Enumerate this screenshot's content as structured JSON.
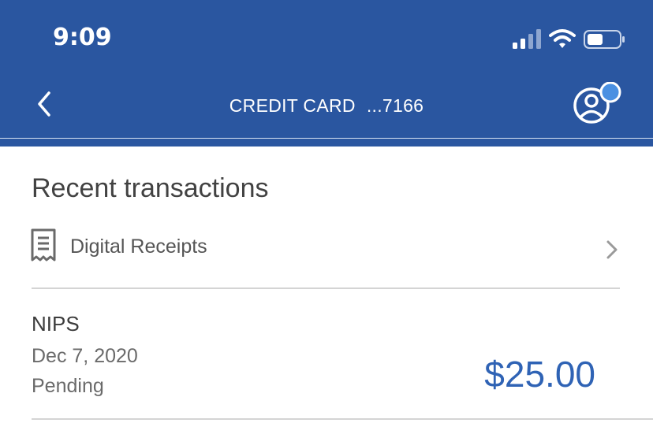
{
  "status_bar": {
    "time": "9:09"
  },
  "header": {
    "title_prefix": "CREDIT CARD",
    "title_suffix": "...7166"
  },
  "main": {
    "section_title": "Recent transactions",
    "receipts_label": "Digital Receipts",
    "transactions": [
      {
        "merchant": "NIPS",
        "date": "Dec 7, 2020",
        "status": "Pending",
        "amount": "$25.00"
      }
    ]
  },
  "colors": {
    "header_bg": "#2a56a0",
    "amount": "#2f63b5",
    "notification_dot": "#4a90e2"
  },
  "icons": [
    "signal-icon",
    "wifi-icon",
    "battery-icon",
    "back-chevron-icon",
    "profile-icon",
    "receipt-icon",
    "chevron-right-icon"
  ]
}
